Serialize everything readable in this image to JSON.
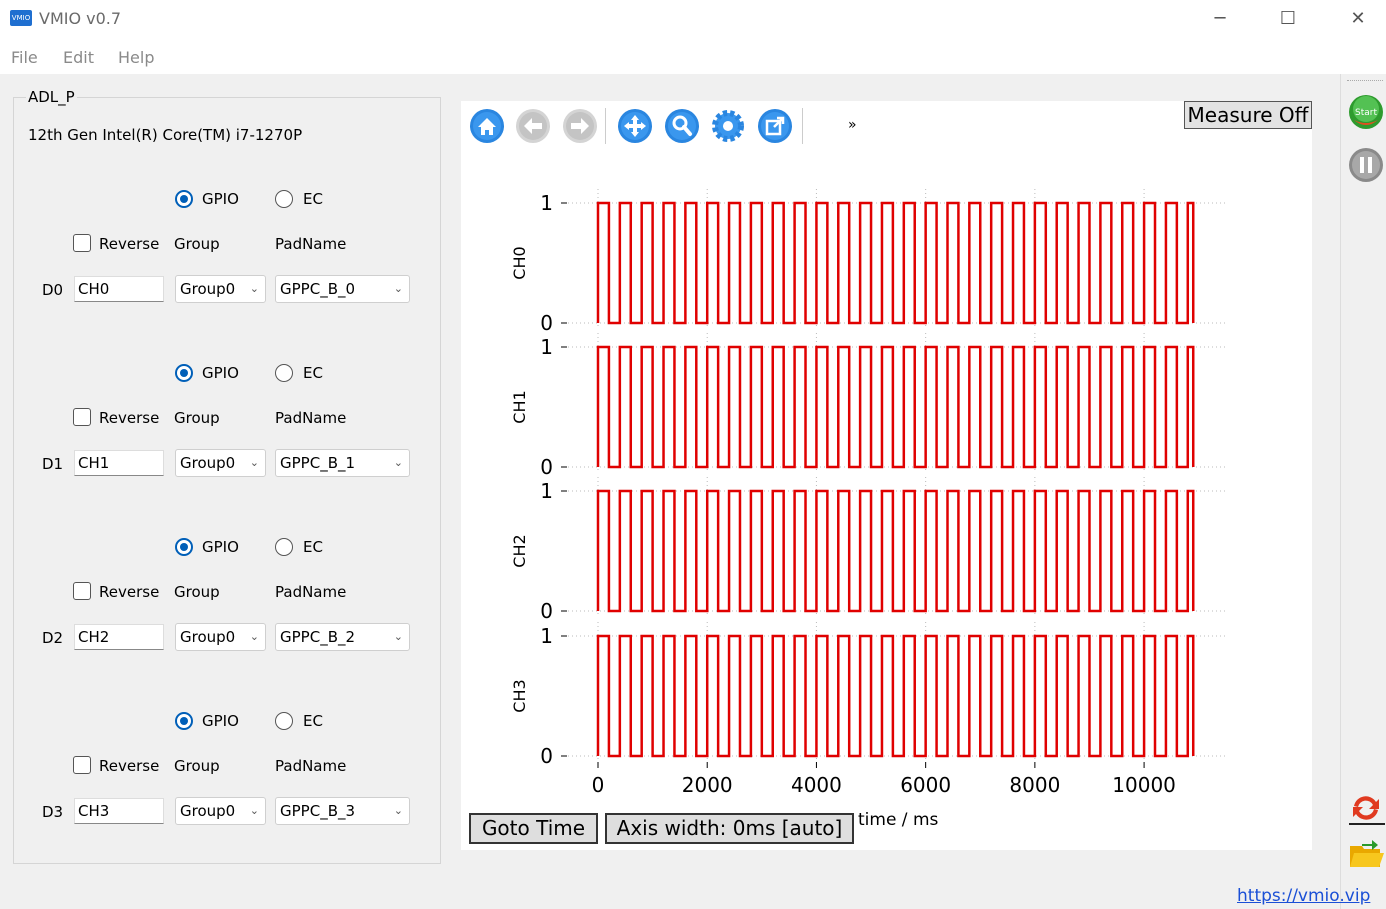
{
  "window": {
    "title": "VMIO v0.7",
    "icon_text": "VMIO",
    "minimize": "─",
    "maximize": "☐",
    "close": "✕"
  },
  "menu": [
    "File",
    "Edit",
    "Help"
  ],
  "panel": {
    "group_title": "ADL_P",
    "cpu": "12th Gen Intel(R) Core(TM) i7-1270P",
    "channels": [
      {
        "d": "D0",
        "name": "CH0",
        "mode": "GPIO",
        "reverse": false,
        "group": "Group0",
        "pad": "GPPC_B_0"
      },
      {
        "d": "D1",
        "name": "CH1",
        "mode": "GPIO",
        "reverse": false,
        "group": "Group0",
        "pad": "GPPC_B_1"
      },
      {
        "d": "D2",
        "name": "CH2",
        "mode": "GPIO",
        "reverse": false,
        "group": "Group0",
        "pad": "GPPC_B_2"
      },
      {
        "d": "D3",
        "name": "CH3",
        "mode": "GPIO",
        "reverse": false,
        "group": "Group0",
        "pad": "GPPC_B_3"
      }
    ],
    "labels": {
      "gpio": "GPIO",
      "ec": "EC",
      "reverse": "Reverse",
      "group": "Group",
      "padname": "PadName"
    }
  },
  "toolbar": {
    "icons": [
      "home-icon",
      "back-arrow-icon",
      "forward-arrow-icon",
      "pan-icon",
      "zoom-icon",
      "settings-icon",
      "export-icon"
    ],
    "overflow": "»"
  },
  "measure_label": "Measure Off",
  "goto_label": "Goto Time",
  "axis_width_label": "Axis width: 0ms [auto]",
  "colors": {
    "trace": "#e00000",
    "accent": "#005fb8",
    "link": "#1a4fd6"
  },
  "chart_data": {
    "type": "line",
    "subplots": [
      "CH0",
      "CH1",
      "CH2",
      "CH3"
    ],
    "xlabel": "time / ms",
    "xlim": [
      0,
      11500
    ],
    "ylim": [
      0,
      1
    ],
    "xticks": [
      0,
      2000,
      4000,
      6000,
      8000,
      10000
    ],
    "yticks": [
      0,
      1
    ],
    "grid": true,
    "signal": {
      "kind": "square",
      "period_ms": 400,
      "start": 0,
      "end": 10900,
      "high": 1,
      "low": 0
    }
  },
  "sidebar": {
    "icons": [
      "start-icon",
      "pause-icon",
      "refresh-icon",
      "open-folder-icon"
    ],
    "start_text": "Start"
  },
  "footer_link": "https://vmio.vip"
}
